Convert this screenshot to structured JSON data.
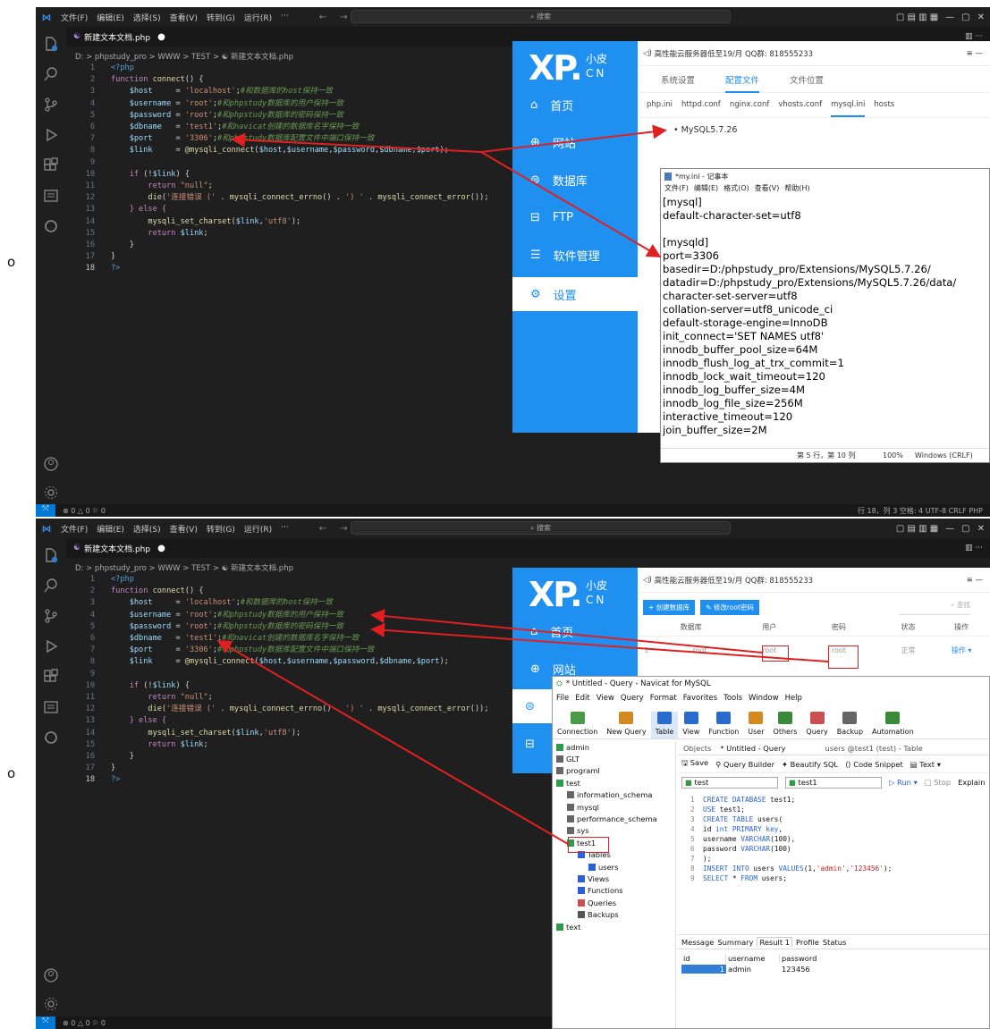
{
  "bullets": [
    "o",
    "o"
  ],
  "vscode": {
    "menu": [
      "文件(F)",
      "编辑(E)",
      "选择(S)",
      "查看(V)",
      "转到(G)",
      "运行(R)",
      "···"
    ],
    "search_label": "搜索",
    "tab_label": "新建文本文档.php",
    "breadcrumb": "D: > phpstudy_pro > WWW > TEST > ☯ 新建文本文档.php",
    "status_left": "⊗ 0 △ 0   ⚐ 0",
    "status_right": "行 18，列 3   空格: 4   UTF-8   CRLF   PHP",
    "code_lines": [
      {
        "n": "1",
        "parts": [
          {
            "t": "<?php",
            "c": "tag"
          }
        ]
      },
      {
        "n": "2",
        "parts": [
          {
            "t": "function ",
            "c": "kw"
          },
          {
            "t": "connect",
            "c": "fn"
          },
          {
            "t": "() {",
            "c": "p"
          }
        ]
      },
      {
        "n": "3",
        "parts": [
          {
            "t": "    $host",
            "c": "var"
          },
          {
            "t": "     = ",
            "c": "p"
          },
          {
            "t": "'localhost'",
            "c": "str"
          },
          {
            "t": ";",
            "c": "p"
          },
          {
            "t": "#和数据库的host保持一致",
            "c": "cm"
          }
        ]
      },
      {
        "n": "4",
        "parts": [
          {
            "t": "    $username",
            "c": "var"
          },
          {
            "t": " = ",
            "c": "p"
          },
          {
            "t": "'root'",
            "c": "str"
          },
          {
            "t": ";",
            "c": "p"
          },
          {
            "t": "#和phpstudy数据库的用户保持一致",
            "c": "cm"
          }
        ]
      },
      {
        "n": "5",
        "parts": [
          {
            "t": "    $password",
            "c": "var"
          },
          {
            "t": " = ",
            "c": "p"
          },
          {
            "t": "'root'",
            "c": "str"
          },
          {
            "t": ";",
            "c": "p"
          },
          {
            "t": "#和phpstudy数据库的密码保持一致",
            "c": "cm"
          }
        ]
      },
      {
        "n": "6",
        "parts": [
          {
            "t": "    $dbname",
            "c": "var"
          },
          {
            "t": "   = ",
            "c": "p"
          },
          {
            "t": "'test1'",
            "c": "str"
          },
          {
            "t": ";",
            "c": "p"
          },
          {
            "t": "#和navicat创建的数据库名字保持一致",
            "c": "cm"
          }
        ]
      },
      {
        "n": "7",
        "parts": [
          {
            "t": "    $port",
            "c": "var"
          },
          {
            "t": "     = ",
            "c": "p"
          },
          {
            "t": "'3306'",
            "c": "str"
          },
          {
            "t": ";",
            "c": "p"
          },
          {
            "t": "#和phpstudy数据库配置文件中端口保持一致",
            "c": "cm"
          }
        ]
      },
      {
        "n": "8",
        "parts": [
          {
            "t": "    $link",
            "c": "var"
          },
          {
            "t": "     = ",
            "c": "p"
          },
          {
            "t": "@mysqli_connect",
            "c": "fn"
          },
          {
            "t": "(",
            "c": "p"
          },
          {
            "t": "$host",
            "c": "var"
          },
          {
            "t": ",",
            "c": "p"
          },
          {
            "t": "$username",
            "c": "var"
          },
          {
            "t": ",",
            "c": "p"
          },
          {
            "t": "$password",
            "c": "var"
          },
          {
            "t": ",",
            "c": "p"
          },
          {
            "t": "$dbname",
            "c": "var"
          },
          {
            "t": ",",
            "c": "p"
          },
          {
            "t": "$port",
            "c": "var"
          },
          {
            "t": ");",
            "c": "p"
          }
        ]
      },
      {
        "n": "9",
        "parts": [
          {
            "t": "",
            "c": "p"
          }
        ]
      },
      {
        "n": "10",
        "parts": [
          {
            "t": "    if ",
            "c": "kw"
          },
          {
            "t": "(!",
            "c": "p"
          },
          {
            "t": "$link",
            "c": "var"
          },
          {
            "t": ") {",
            "c": "p"
          }
        ]
      },
      {
        "n": "11",
        "parts": [
          {
            "t": "        return ",
            "c": "kw"
          },
          {
            "t": "\"null\"",
            "c": "str"
          },
          {
            "t": ";",
            "c": "p"
          }
        ]
      },
      {
        "n": "12",
        "parts": [
          {
            "t": "        die",
            "c": "fn"
          },
          {
            "t": "(",
            "c": "p"
          },
          {
            "t": "'连接错误 ('",
            "c": "str"
          },
          {
            "t": " . ",
            "c": "p"
          },
          {
            "t": "mysqli_connect_errno",
            "c": "fn"
          },
          {
            "t": "() . ",
            "c": "p"
          },
          {
            "t": "') '",
            "c": "str"
          },
          {
            "t": " . ",
            "c": "p"
          },
          {
            "t": "mysqli_connect_error",
            "c": "fn"
          },
          {
            "t": "());",
            "c": "p"
          }
        ]
      },
      {
        "n": "13",
        "parts": [
          {
            "t": "    } else {",
            "c": "kw"
          }
        ]
      },
      {
        "n": "14",
        "parts": [
          {
            "t": "        mysqli_set_charset",
            "c": "fn"
          },
          {
            "t": "(",
            "c": "p"
          },
          {
            "t": "$link",
            "c": "var"
          },
          {
            "t": ",",
            "c": "p"
          },
          {
            "t": "'utf8'",
            "c": "str"
          },
          {
            "t": ");",
            "c": "p"
          }
        ]
      },
      {
        "n": "15",
        "parts": [
          {
            "t": "        return ",
            "c": "kw"
          },
          {
            "t": "$link",
            "c": "var"
          },
          {
            "t": ";",
            "c": "p"
          }
        ]
      },
      {
        "n": "16",
        "parts": [
          {
            "t": "    }",
            "c": "p"
          }
        ]
      },
      {
        "n": "17",
        "parts": [
          {
            "t": "}",
            "c": "p"
          }
        ]
      },
      {
        "n": "18",
        "parts": [
          {
            "t": "?>",
            "c": "tag"
          }
        ]
      }
    ]
  },
  "xp": {
    "logo_main": "XP.",
    "logo_sub1": "小皮",
    "logo_sub2": "CN",
    "nav": [
      "首页",
      "网站",
      "数据库",
      "FTP",
      "软件管理",
      "设置"
    ],
    "topbar": "高性能云服务器低至19/月  QQ群: 818555233",
    "tabs": [
      "系统设置",
      "配置文件",
      "文件位置"
    ],
    "subtabs": [
      "php.ini",
      "httpd.conf",
      "nginx.conf",
      "vhosts.conf",
      "mysql.ini",
      "hosts"
    ],
    "version_item": "MySQL5.7.26",
    "db_buttons": [
      "+ 创建数据库",
      "✎ 修改root密码"
    ],
    "db_search": "查找",
    "db_headers": [
      "数据库",
      "用户",
      "密码",
      "状态",
      "操作"
    ],
    "db_row": [
      "1",
      "root",
      "root",
      "root",
      "正常",
      "操作 ▾"
    ]
  },
  "notepad": {
    "title": "*my.ini - 记事本",
    "menu": [
      "文件(F)",
      "编辑(E)",
      "格式(O)",
      "查看(V)",
      "帮助(H)"
    ],
    "lines": [
      "[mysql]",
      "default-character-set=utf8",
      "",
      "[mysqld]",
      "port=3306",
      "basedir=D:/phpstudy_pro/Extensions/MySQL5.7.26/",
      "datadir=D:/phpstudy_pro/Extensions/MySQL5.7.26/data/",
      "character-set-server=utf8",
      "collation-server=utf8_unicode_ci",
      "default-storage-engine=InnoDB",
      "init_connect='SET NAMES utf8'",
      "innodb_buffer_pool_size=64M",
      "innodb_flush_log_at_trx_commit=1",
      "innodb_lock_wait_timeout=120",
      "innodb_log_buffer_size=4M",
      "innodb_log_file_size=256M",
      "interactive_timeout=120",
      "join_buffer_size=2M"
    ],
    "status": [
      "第 5 行，第 10 列",
      "100%",
      "Windows (CRLF)"
    ]
  },
  "navicat": {
    "title": "* Untitled - Query - Navicat for MySQL",
    "menu": [
      "File",
      "Edit",
      "View",
      "Query",
      "Format",
      "Favorites",
      "Tools",
      "Window",
      "Help"
    ],
    "tools": [
      "Connection",
      "New Query",
      "Table",
      "View",
      "Function",
      "User",
      "Others",
      "Query",
      "Backup",
      "Automation"
    ],
    "tool_colors": [
      "#4a9a4a",
      "#d08a20",
      "#2a6bd0",
      "#2a6bd0",
      "#2a6bd0",
      "#d08a20",
      "#3a8a3a",
      "#c85050",
      "#666666",
      "#3a8a3a"
    ],
    "tree": [
      {
        "label": "admin",
        "indent": 0,
        "icon": "db-green"
      },
      {
        "label": "GLT",
        "indent": 0,
        "icon": "db-gray"
      },
      {
        "label": "programl",
        "indent": 0,
        "icon": "db-gray"
      },
      {
        "label": "test",
        "indent": 0,
        "icon": "db-green"
      },
      {
        "label": "information_schema",
        "indent": 1,
        "icon": "db-gray"
      },
      {
        "label": "mysql",
        "indent": 1,
        "icon": "db-gray"
      },
      {
        "label": "performance_schema",
        "indent": 1,
        "icon": "db-gray"
      },
      {
        "label": "sys",
        "indent": 1,
        "icon": "db-gray"
      },
      {
        "label": "test1",
        "indent": 1,
        "icon": "db-green"
      },
      {
        "label": "Tables",
        "indent": 2,
        "icon": "table"
      },
      {
        "label": "users",
        "indent": 3,
        "icon": "table"
      },
      {
        "label": "Views",
        "indent": 2,
        "icon": "view"
      },
      {
        "label": "Functions",
        "indent": 2,
        "icon": "fx"
      },
      {
        "label": "Queries",
        "indent": 2,
        "icon": "query"
      },
      {
        "label": "Backups",
        "indent": 2,
        "icon": "backup"
      },
      {
        "label": "text",
        "indent": 0,
        "icon": "db-green"
      }
    ],
    "objtabs": [
      "Objects",
      "* Untitled - Query",
      "users @test1 (test) - Table"
    ],
    "qtoolbar": [
      "Save",
      "Query Builder",
      "Beautify SQL",
      "Code Snippet",
      "Text ▾"
    ],
    "conn_select": "test",
    "db_select": "test1",
    "run_buttons": [
      "▷ Run ▾",
      "□ Stop",
      "Explain"
    ],
    "sql": [
      [
        {
          "t": "CREATE DATABASE ",
          "c": "kw"
        },
        {
          "t": "test1;",
          "c": "p"
        }
      ],
      [
        {
          "t": "USE ",
          "c": "kw"
        },
        {
          "t": "test1;",
          "c": "p"
        }
      ],
      [
        {
          "t": "CREATE TABLE ",
          "c": "kw"
        },
        {
          "t": "users(",
          "c": "p"
        }
      ],
      [
        {
          "t": "id ",
          "c": "p"
        },
        {
          "t": "int PRIMARY key",
          "c": "kw"
        },
        {
          "t": ",",
          "c": "p"
        }
      ],
      [
        {
          "t": "username ",
          "c": "p"
        },
        {
          "t": "VARCHAR",
          "c": "kw"
        },
        {
          "t": "(100),",
          "c": "p"
        }
      ],
      [
        {
          "t": "password ",
          "c": "p"
        },
        {
          "t": "VARCHAR",
          "c": "kw"
        },
        {
          "t": "(100)",
          "c": "p"
        }
      ],
      [
        {
          "t": ");",
          "c": "p"
        }
      ],
      [
        {
          "t": "INSERT INTO ",
          "c": "kw"
        },
        {
          "t": "users ",
          "c": "p"
        },
        {
          "t": "VALUES",
          "c": "kw"
        },
        {
          "t": "(1,",
          "c": "p"
        },
        {
          "t": "'admin'",
          "c": "str"
        },
        {
          "t": ",",
          "c": "p"
        },
        {
          "t": "'123456'",
          "c": "str"
        },
        {
          "t": ");",
          "c": "p"
        }
      ],
      [
        {
          "t": "SELECT ",
          "c": "kw"
        },
        {
          "t": "* ",
          "c": "p"
        },
        {
          "t": "FROM ",
          "c": "kw"
        },
        {
          "t": "users;",
          "c": "p"
        }
      ]
    ],
    "result_tabs": [
      "Message",
      "Summary",
      "Result 1",
      "Profile",
      "Status"
    ],
    "result_headers": [
      "id",
      "username",
      "password"
    ],
    "result_row": [
      "1",
      "admin",
      "123456"
    ]
  },
  "colors": {
    "editor_bg": "#1f1f1f",
    "xp_blue": "#1f8ff0",
    "arrow_red": "#e02020",
    "code_var": "#9cdcfe",
    "code_str": "#ce9178",
    "code_kw": "#c586c0",
    "code_fn": "#dcdcaa",
    "code_cm": "#6a9955",
    "code_tag": "#569cd6"
  }
}
